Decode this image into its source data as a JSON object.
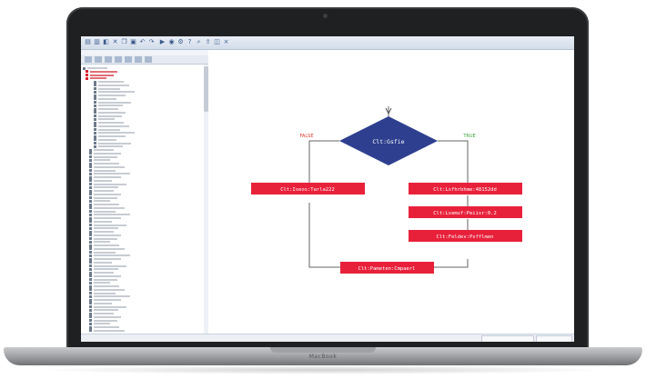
{
  "brand": {
    "device_label": "MacBook"
  },
  "toolbar": {
    "icons": [
      "new-icon",
      "open-icon",
      "save-icon",
      "cut-icon",
      "copy-icon",
      "paste-icon",
      "undo-icon",
      "redo-icon",
      "run-icon",
      "debug-icon",
      "settings-icon",
      "help-icon",
      "zoom-icon",
      "export-icon",
      "window-icon",
      "close-icon"
    ]
  },
  "flowchart": {
    "decision": "Clt:Gsfie",
    "branch_false": "FALSE",
    "branch_true": "TRUE",
    "left_action": "Clt:Iseos:Tarla222",
    "right_actions": [
      "Clt:Lsfhrbhme:48152dd",
      "Clt:Lsemsf:Peiisr:0.2",
      "Clt:Feldev:Psfflmen"
    ],
    "merge_action": "Clt:Pameten:Cmpaerl"
  },
  "colors": {
    "decision_fill": "#2e3f8f",
    "action_fill": "#e8213b",
    "false_label": "#d9372b",
    "true_label": "#3aa23a",
    "connector": "#666666"
  }
}
